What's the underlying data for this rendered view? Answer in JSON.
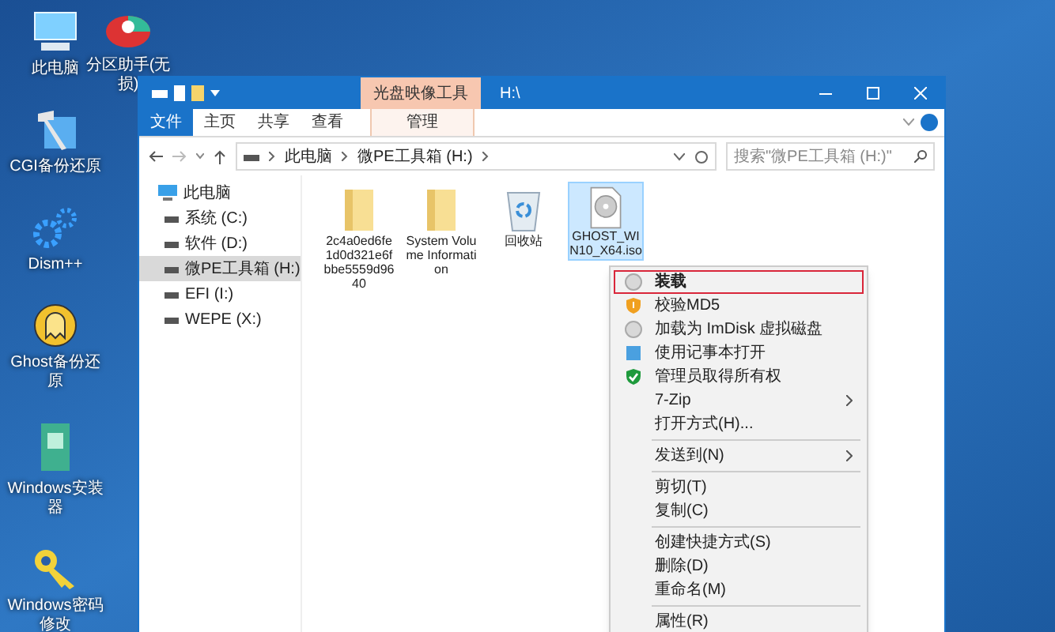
{
  "desktop_icons": [
    {
      "label": "此电脑",
      "kind": "pc"
    },
    {
      "label": "CGI备份还原",
      "kind": "tool"
    },
    {
      "label": "Dism++",
      "kind": "gear"
    },
    {
      "label": "Ghost备份还原",
      "kind": "ghost"
    },
    {
      "label": "Windows安装器",
      "kind": "installer"
    },
    {
      "label": "Windows密码修改",
      "kind": "key"
    }
  ],
  "desktop_icon_top": {
    "label": "分区助手(无损)",
    "kind": "disk"
  },
  "window": {
    "title": "H:\\",
    "tool_group": "光盘映像工具"
  },
  "tabs": [
    {
      "label": "文件",
      "kind": "file",
      "selected": false
    },
    {
      "label": "主页",
      "kind": "plain",
      "selected": false
    },
    {
      "label": "共享",
      "kind": "plain",
      "selected": false
    },
    {
      "label": "查看",
      "kind": "plain",
      "selected": false
    },
    {
      "label": "管理",
      "kind": "tool",
      "selected": false
    }
  ],
  "address": {
    "path": [
      "此电脑",
      "微PE工具箱 (H:)"
    ]
  },
  "search": {
    "placeholder": "搜索\"微PE工具箱 (H:)\""
  },
  "sidebar": {
    "items": [
      {
        "label": "此电脑",
        "selected": false,
        "children": [
          {
            "label": "系统 (C:)",
            "selected": false
          },
          {
            "label": "软件 (D:)",
            "selected": false
          },
          {
            "label": "微PE工具箱 (H:)",
            "selected": true
          },
          {
            "label": "EFI (I:)",
            "selected": false
          },
          {
            "label": "WEPE (X:)",
            "selected": false
          }
        ]
      }
    ]
  },
  "files": [
    {
      "name": "2c4a0ed6fe1d0d321e6fbbe5559d9640",
      "kind": "folder",
      "selected": false
    },
    {
      "name": "System Volume Information",
      "kind": "folder",
      "selected": false
    },
    {
      "name": "回收站",
      "kind": "recycle",
      "selected": false
    },
    {
      "name": "GHOST_WIN10_X64.iso",
      "kind": "disc",
      "selected": true
    }
  ],
  "context_menu": [
    {
      "kind": "disc",
      "label": "装载",
      "bold": true,
      "selected": true
    },
    {
      "kind": "shield",
      "label": "校验MD5",
      "bold": false,
      "selected": false
    },
    {
      "kind": "disc",
      "label": "加载为 ImDisk 虚拟磁盘",
      "bold": false,
      "selected": false
    },
    {
      "kind": "notepad",
      "label": "使用记事本打开",
      "bold": false,
      "selected": false
    },
    {
      "kind": "check",
      "label": "管理员取得所有权",
      "bold": false,
      "selected": false
    },
    {
      "kind": "submenu",
      "label": "7-Zip",
      "bold": false,
      "selected": false
    },
    {
      "kind": "plain",
      "label": "打开方式(H)...",
      "bold": false,
      "selected": false
    },
    {
      "kind": "separator"
    },
    {
      "kind": "submenu",
      "label": "发送到(N)",
      "bold": false,
      "selected": false
    },
    {
      "kind": "separator"
    },
    {
      "kind": "plain",
      "label": "剪切(T)",
      "bold": false,
      "selected": false
    },
    {
      "kind": "plain",
      "label": "复制(C)",
      "bold": false,
      "selected": false
    },
    {
      "kind": "separator"
    },
    {
      "kind": "plain",
      "label": "创建快捷方式(S)",
      "bold": false,
      "selected": false
    },
    {
      "kind": "plain",
      "label": "删除(D)",
      "bold": false,
      "selected": false
    },
    {
      "kind": "plain",
      "label": "重命名(M)",
      "bold": false,
      "selected": false
    },
    {
      "kind": "separator"
    },
    {
      "kind": "plain",
      "label": "属性(R)",
      "bold": false,
      "selected": false
    }
  ]
}
